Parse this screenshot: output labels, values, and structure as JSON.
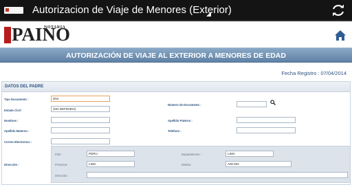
{
  "actionbar": {
    "app_logo_text": "PAINO",
    "title": "Autorizacion de Viaje de Menores (Exterior)",
    "refresh_icon": "refresh-icon"
  },
  "header": {
    "logo_top": "NOTARIA",
    "logo_word": "PAINO",
    "home_icon": "home-icon"
  },
  "banner": {
    "title": "AUTORIZACIÓN DE VIAJE AL EXTERIOR A MENORES DE EDAD"
  },
  "fecha": {
    "label": "Fecha Registro :",
    "value": "07/04/2014"
  },
  "colors": {
    "banner": "#6a8cb0",
    "label": "#2c5281",
    "focus_border": "#e6a25a"
  },
  "section": {
    "title": "DATOS DEL PADRE",
    "fields": {
      "tipo_documento": {
        "label": "Tipo Documento :",
        "value": "DNI"
      },
      "numero_documento": {
        "label": "Número de Documento :",
        "value": ""
      },
      "estado_civil": {
        "label": "Estado Civil :",
        "value": "(NO DEFINIDO)"
      },
      "nombres": {
        "label": "Nombres :",
        "value": ""
      },
      "apellido_paterno": {
        "label": "Apellido Paterno :",
        "value": ""
      },
      "apellido_materno": {
        "label": "Apellido Materno :",
        "value": ""
      },
      "telefono": {
        "label": "Telefono :",
        "value": ""
      },
      "correo": {
        "label": "Correo Electronico :",
        "value": ""
      }
    },
    "direccion": {
      "label": "Dirección :",
      "pais": {
        "label": "País :",
        "value": "PERU"
      },
      "departamento": {
        "label": "Departamento :",
        "value": "LIMA"
      },
      "provincia": {
        "label": "Provincia :",
        "value": "LIMA"
      },
      "distrito": {
        "label": "Distrito :",
        "value": "ANCON"
      },
      "direccion": {
        "label": "Dirección :",
        "value": ""
      }
    }
  }
}
